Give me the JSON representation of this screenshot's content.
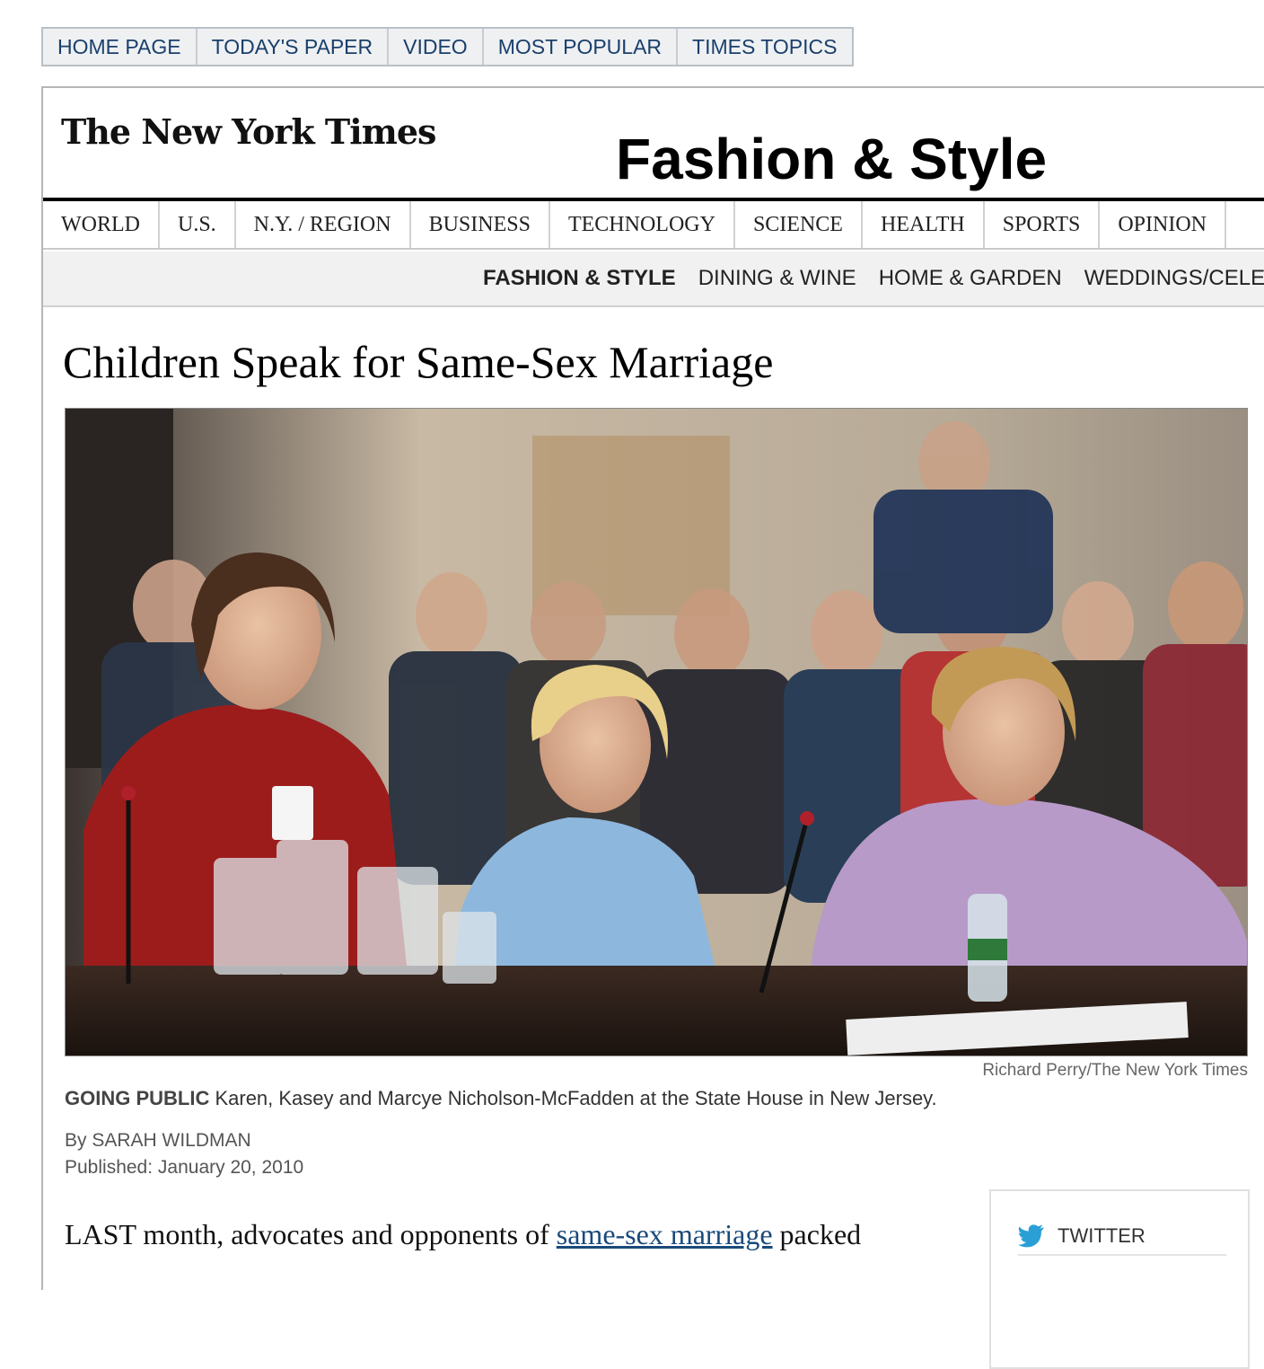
{
  "top_nav": [
    "HOME PAGE",
    "TODAY'S PAPER",
    "VIDEO",
    "MOST POPULAR",
    "TIMES TOPICS"
  ],
  "masthead": {
    "logo_text": "The New York Times",
    "section_title": "Fashion & Style"
  },
  "section_nav": [
    "WORLD",
    "U.S.",
    "N.Y. / REGION",
    "BUSINESS",
    "TECHNOLOGY",
    "SCIENCE",
    "HEALTH",
    "SPORTS",
    "OPINION"
  ],
  "sub_nav": {
    "items": [
      "FASHION & STYLE",
      "DINING & WINE",
      "HOME & GARDEN",
      "WEDDINGS/CELEB"
    ],
    "active": "FASHION & STYLE"
  },
  "article": {
    "headline": "Children Speak for Same-Sex Marriage",
    "photo_credit": "Richard Perry/The New York Times",
    "caption_kicker": "GOING PUBLIC",
    "caption_text": " Karen, Kasey and Marcye Nicholson-McFadden at the State House in New Jersey.",
    "byline": "By SARAH WILDMAN",
    "published": "Published: January 20, 2010",
    "body_start": "LAST month, advocates and opponents of ",
    "body_link": "same-sex marriage",
    "body_end": " packed"
  },
  "share": {
    "twitter_label": "TWITTER",
    "twitter_icon": "twitter-bird-icon",
    "twitter_color": "#2a9fd6"
  }
}
